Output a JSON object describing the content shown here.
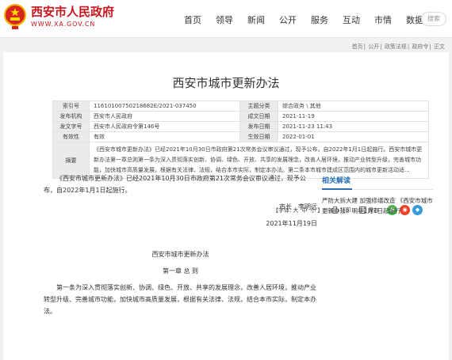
{
  "header": {
    "site_name": "西安市人民政府",
    "site_url": "WWW.XA.GOV.CN",
    "nav": [
      "首页",
      "领导",
      "新闻",
      "公开",
      "服务",
      "互动",
      "市情",
      "数据"
    ],
    "search_label": "搜索"
  },
  "breadcrumb": [
    "首页",
    "公开",
    "政策法规",
    "政府令",
    "正文"
  ],
  "article": {
    "title": "西安市城市更新办法",
    "meta": {
      "index_label": "索引号",
      "index_value": "11610100750218682E/2021-037450",
      "category_label": "主题分类",
      "category_value": "综合政务 \\ 其他",
      "issuer_label": "发布机构",
      "issuer_value": "西安市人民政府",
      "formed_label": "成文日期",
      "formed_value": "2021-11-19",
      "docno_label": "发文字号",
      "docno_value": "西安市人民政府令第146号",
      "published_label": "发布日期",
      "published_value": "2021-11-23 11:43",
      "validity_label": "有效性",
      "validity_value": "有效",
      "effective_label": "生效日期",
      "effective_value": "2022-01-01",
      "summary_label": "摘要",
      "summary_value": "《西安市城市更新办法》已经2021年10月30日市政府第21次常务会议审议通过，现予公布，自2022年1月1日起施行。西安市城市更新办法第一章总则第一条为深入贯彻落实创新、协调、绿色、开放、共享的发展理念，改善人居环境，推动产业转型升级，完善城市功能，加快城市高质量发展，根据有关法律、法规，结合本市实际，制定本办法。第二条本市城市建成区范围内的城市更新活动适..."
    },
    "tools": {
      "font_label": "【字体:",
      "font_large": "大",
      "font_medium": "中",
      "font_small": "小",
      "font_close": "】",
      "print_label": "打印",
      "save_label": "保存"
    },
    "body": {
      "intro": "《西安市城市更新办法》已经2021年10月30日市政府第21次常务会议审议通过，现予公布，自2022年1月1日起施行。",
      "signature": "市长　李明远",
      "date": "2021年11月19日",
      "doc_title": "西安市城市更新办法",
      "chapter": "第一章 总 则",
      "article1": "第一条为深入贯彻落实创新、协调、绿色、开放、共享的发展理念，改善人居环境，推动产业转型升级、完善城市功能，加快城市高质量发展，根据有关法律、法规，结合本市实际，制定本办法。"
    }
  },
  "related": {
    "title": "相关解读",
    "items": [
      "严防大拆大建 加强修缮改造 《西安市城市更新办法》明年1月1日起施行"
    ]
  },
  "colors": {
    "brand_red": "#c8151c",
    "link_blue": "#2a6fb5"
  }
}
